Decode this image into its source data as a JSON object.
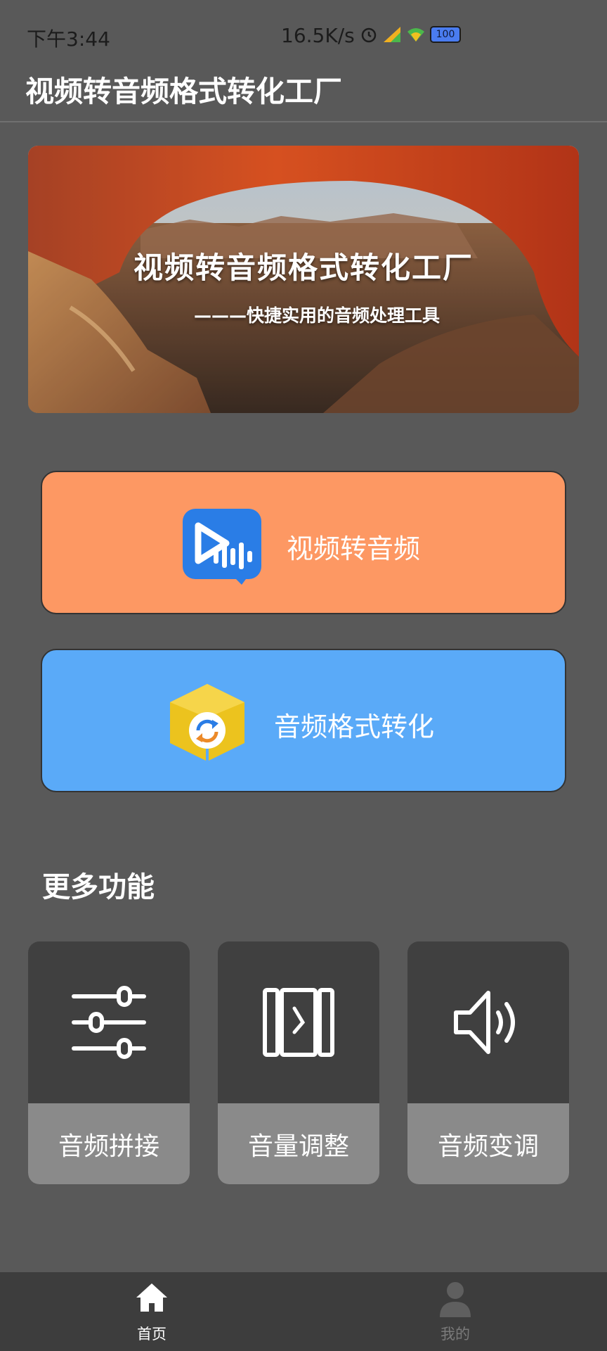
{
  "status_bar": {
    "time": "下午3:44",
    "network_speed": "16.5K/s",
    "battery": "100"
  },
  "app": {
    "title": "视频转音频格式转化工厂"
  },
  "banner": {
    "title": "视频转音频格式转化工厂",
    "subtitle": "———快捷实用的音频处理工具"
  },
  "actions": {
    "video_to_audio": "视频转音频",
    "audio_format_convert": "音频格式转化"
  },
  "more": {
    "title": "更多功能",
    "items": [
      {
        "label": "音频拼接",
        "icon": "sliders-icon"
      },
      {
        "label": "音量调整",
        "icon": "volume-panel-icon"
      },
      {
        "label": "音频变调",
        "icon": "speaker-icon"
      }
    ]
  },
  "nav": {
    "home": "首页",
    "mine": "我的"
  },
  "colors": {
    "background": "#595959",
    "orange_button": "#fd9863",
    "blue_button": "#5aaaf8",
    "card_top": "#404040",
    "card_bottom": "#8a8a8a",
    "nav_bg": "#3d3d3d"
  }
}
